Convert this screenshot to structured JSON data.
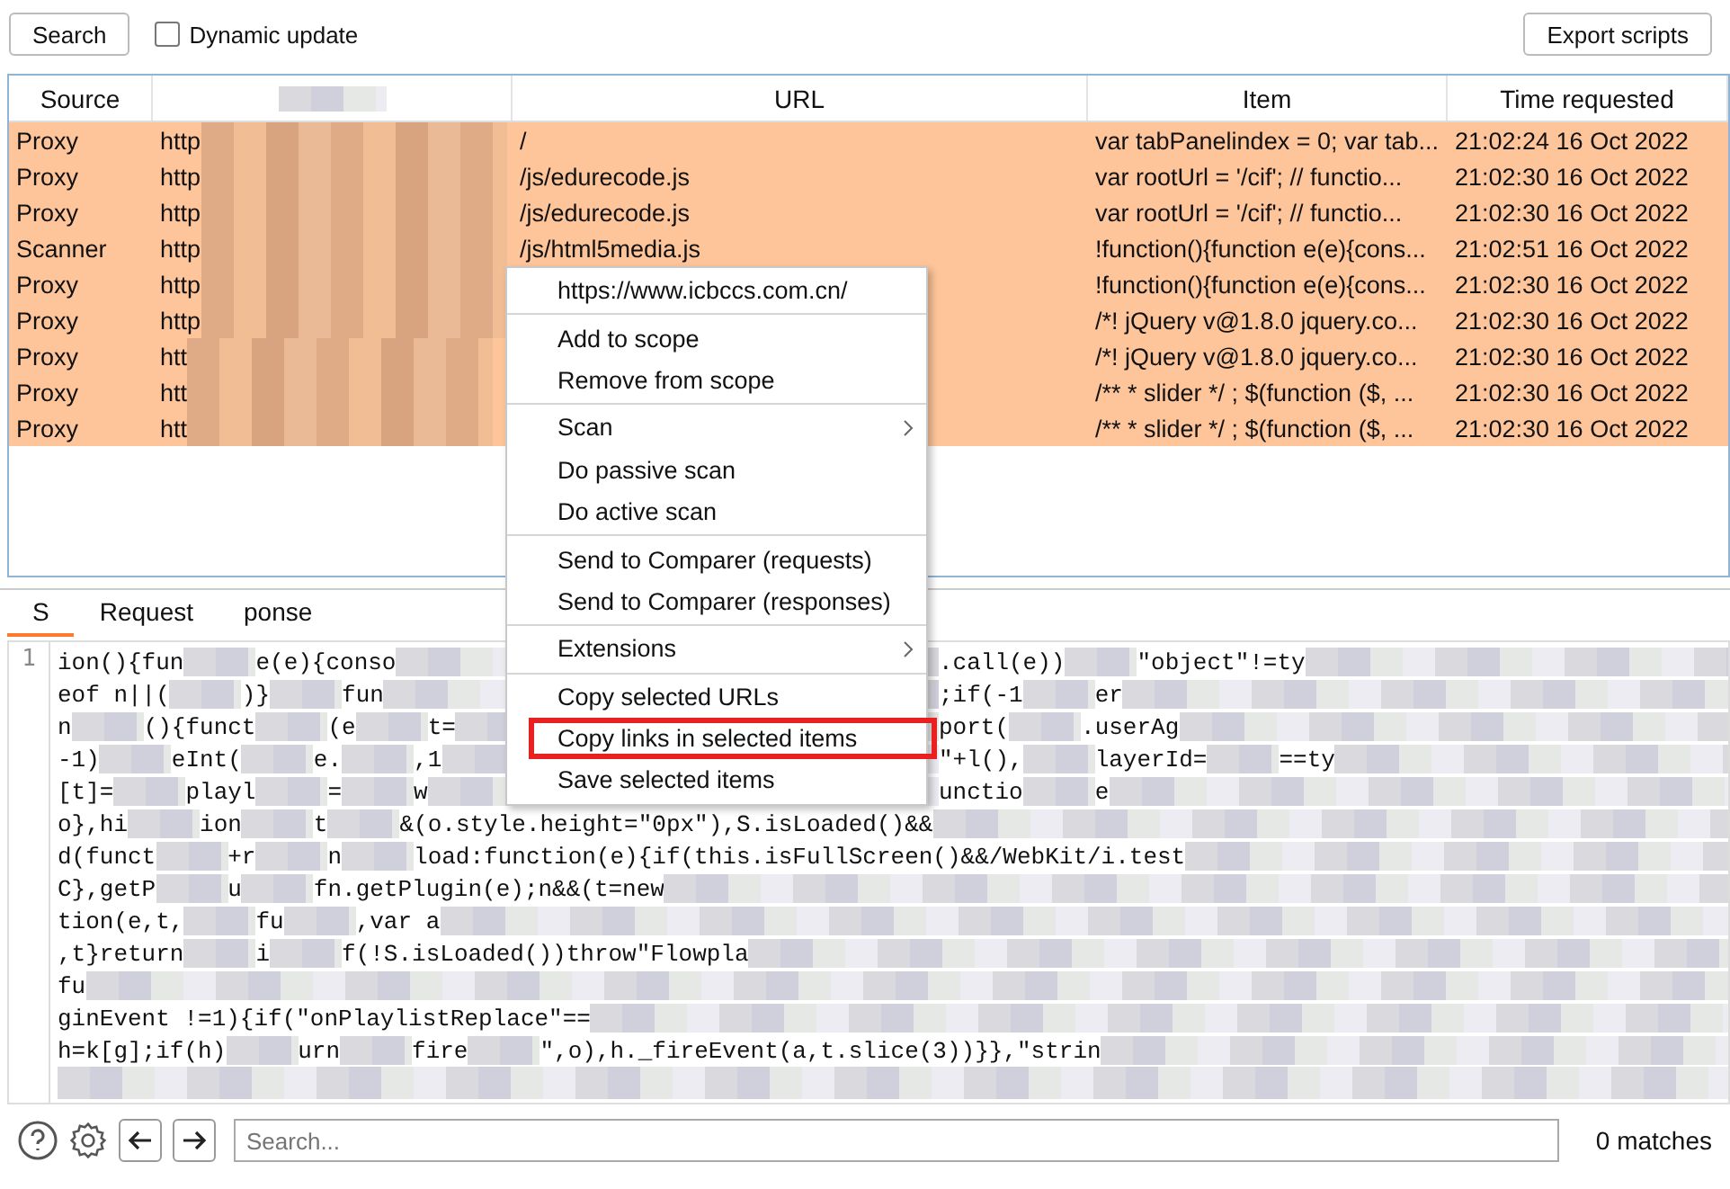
{
  "toolbar": {
    "search_button": "Search",
    "dynamic_update": {
      "label": "Dynamic update",
      "checked": false
    },
    "export_button": "Export scripts"
  },
  "table": {
    "columns": [
      "Source",
      "",
      "URL",
      "Item",
      "Time requested"
    ],
    "rows": [
      {
        "source": "Proxy",
        "host": "http",
        "url": "/",
        "item": "var tabPanelindex = 0; var tab...",
        "time": "21:02:24 16 Oct 2022",
        "selected": true
      },
      {
        "source": "Proxy",
        "host": "http",
        "url": "/js/edurecode.js",
        "item": "var rootUrl = '/cif'; // functio...",
        "time": "21:02:30 16 Oct 2022",
        "selected": true
      },
      {
        "source": "Proxy",
        "host": "http",
        "url": "/js/edurecode.js",
        "item": "var rootUrl = '/cif'; // functio...",
        "time": "21:02:30 16 Oct 2022",
        "selected": true
      },
      {
        "source": "Scanner",
        "host": "http",
        "url": "/js/html5media.js",
        "item": "!function(){function e(e){cons...",
        "time": "21:02:51 16 Oct 2022",
        "selected": true
      },
      {
        "source": "Proxy",
        "host": "http",
        "item": "!function(){function e(e){cons...",
        "time": "21:02:30 16 Oct 2022",
        "selected": true
      },
      {
        "source": "Proxy",
        "host": "http",
        "item": "/*! jQuery v@1.8.0 jquery.co...",
        "time": "21:02:30 16 Oct 2022",
        "selected": true
      },
      {
        "source": "Proxy",
        "host": "htt",
        "item": "/*! jQuery v@1.8.0 jquery.co...",
        "time": "21:02:30 16 Oct 2022",
        "selected": true
      },
      {
        "source": "Proxy",
        "host": "htt",
        "item": "/** * slider */ ; $(function ($, ...",
        "time": "21:02:30 16 Oct 2022",
        "selected": true
      },
      {
        "source": "Proxy",
        "host": "htt",
        "item": "/** * slider */ ; $(function ($, ...",
        "time": "21:02:30 16 Oct 2022",
        "selected": true
      }
    ]
  },
  "context_menu": {
    "groups": [
      [
        {
          "label": "https://www.icbccs.com.cn/",
          "submenu": false,
          "highlighted": false
        }
      ],
      [
        {
          "label": "Add to scope",
          "submenu": false,
          "highlighted": false
        },
        {
          "label": "Remove from scope",
          "submenu": false,
          "highlighted": false
        }
      ],
      [
        {
          "label": "Scan",
          "submenu": true,
          "highlighted": false
        },
        {
          "label": "Do passive scan",
          "submenu": false,
          "highlighted": false
        },
        {
          "label": "Do active scan",
          "submenu": false,
          "highlighted": false
        }
      ],
      [
        {
          "label": "Send to Comparer (requests)",
          "submenu": false,
          "highlighted": false
        },
        {
          "label": "Send to Comparer (responses)",
          "submenu": false,
          "highlighted": false
        }
      ],
      [
        {
          "label": "Extensions",
          "submenu": true,
          "highlighted": false
        }
      ],
      [
        {
          "label": "Copy selected URLs",
          "submenu": false,
          "highlighted": false
        },
        {
          "label": "Copy links in selected items",
          "submenu": false,
          "highlighted": true
        },
        {
          "label": "Save selected items",
          "submenu": false,
          "highlighted": false
        }
      ]
    ]
  },
  "tabs": [
    {
      "label": "S",
      "selected": true
    },
    {
      "label": "Request",
      "selected": false
    },
    {
      "label": "ponse",
      "selected": false
    }
  ],
  "editor": {
    "line_number": "1",
    "lines": [
      {
        "left": [
          "ion(){fun",
          "e(e){conso"
        ],
        "right": [
          ".call(e))",
          "\"object\"!=ty"
        ]
      },
      {
        "left": [
          "eof n||(",
          ")}",
          "fun"
        ],
        "right": [
          ";if(-1",
          "er"
        ]
      },
      {
        "left": [
          "n",
          "(){funct",
          "(e",
          "t="
        ],
        "right": [
          "port(",
          ".userAg"
        ]
      },
      {
        "left": [
          "-1)",
          "eInt(",
          "e.",
          ",1"
        ],
        "right": [
          "\"+l(),",
          "layerId=",
          "==ty"
        ]
      },
      {
        "left": [
          "[t]=",
          "playl",
          "=",
          "w"
        ],
        "right": [
          "unctio",
          "e"
        ]
      },
      {
        "left": [
          "o},hi",
          "ion",
          "t",
          "&(o.style.height=\"0px\"),S.isLoaded()&&"
        ]
      },
      {
        "left": [
          "d(funct",
          "+r",
          "n",
          "load:function(e){if(this.isFullScreen()&&/WebKit/i.test"
        ]
      },
      {
        "left": [
          "C},getP",
          "u",
          "fn.getPlugin(e);n&&(t=new"
        ]
      },
      {
        "left": [
          "tion(e,t,",
          "fu",
          ",var a"
        ]
      },
      {
        "left": [
          ",t}return",
          "i",
          "f(!S.isLoaded())throw\"Flowpla"
        ]
      },
      {
        "left": [
          "fu"
        ]
      },
      {
        "left": [
          "ginEvent !=1){if(\"onPlaylistReplace\"=="
        ]
      },
      {
        "left": [
          "h=k[g];if(h)",
          "urn",
          "fire",
          "\",o),h._fireEvent(a,t.slice(3))}},\"strin"
        ]
      }
    ]
  },
  "footer": {
    "search": {
      "placeholder": "Search..."
    },
    "matches": "0 matches"
  }
}
